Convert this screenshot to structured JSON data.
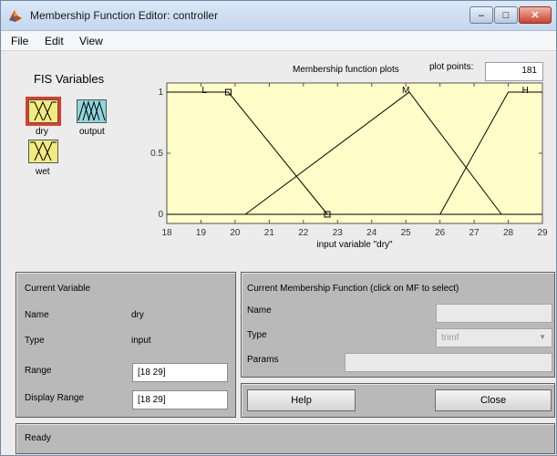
{
  "window": {
    "title": "Membership Function Editor: controller",
    "minimize_label": "–",
    "maximize_label": "□",
    "close_label": "✕"
  },
  "menu": {
    "items": [
      {
        "label": "File"
      },
      {
        "label": "Edit"
      },
      {
        "label": "View"
      }
    ]
  },
  "fis": {
    "title": "FIS Variables",
    "variables": [
      {
        "name": "dry",
        "kind": "input",
        "selected": true
      },
      {
        "name": "output",
        "kind": "output",
        "selected": false
      },
      {
        "name": "wet",
        "kind": "input",
        "selected": false
      }
    ]
  },
  "plot_header": {
    "title": "Membership function plots",
    "points_label": "plot points:",
    "points_value": "181"
  },
  "chart_data": {
    "type": "line",
    "xlabel": "input variable \"dry\"",
    "ylabel": "",
    "xlim": [
      18,
      29
    ],
    "ylim": [
      0,
      1
    ],
    "x_ticks": [
      "18",
      "19",
      "20",
      "21",
      "22",
      "23",
      "24",
      "25",
      "26",
      "27",
      "28",
      "29"
    ],
    "y_ticks": [
      "0",
      "0.5",
      "1"
    ],
    "series": [
      {
        "name": "L",
        "x": [
          18,
          19.8,
          22.7
        ],
        "y": [
          1,
          1,
          0
        ],
        "label_at": 19.1
      },
      {
        "name": "M",
        "x": [
          20.3,
          25.1,
          27.8
        ],
        "y": [
          0,
          1,
          0
        ],
        "label_at": 25.0
      },
      {
        "name": "H",
        "x": [
          26,
          28,
          29
        ],
        "y": [
          0,
          1,
          1
        ],
        "label_at": 28.5
      }
    ],
    "selected_markers": [
      {
        "x": 19.8,
        "y": 1
      },
      {
        "x": 22.7,
        "y": 0
      }
    ],
    "colors": {
      "background": "#fffdc8",
      "line": "#000000"
    }
  },
  "current_variable": {
    "title": "Current Variable",
    "name_label": "Name",
    "name_value": "dry",
    "type_label": "Type",
    "type_value": "input",
    "range_label": "Range",
    "range_value": "[18 29]",
    "display_range_label": "Display Range",
    "display_range_value": "[18 29]"
  },
  "current_mf": {
    "title": "Current Membership Function (click on MF to select)",
    "name_label": "Name",
    "name_value": "",
    "type_label": "Type",
    "type_value": "trimf",
    "params_label": "Params",
    "params_value": ""
  },
  "buttons": {
    "help_label": "Help",
    "close_label": "Close"
  },
  "status": {
    "text": "Ready"
  }
}
